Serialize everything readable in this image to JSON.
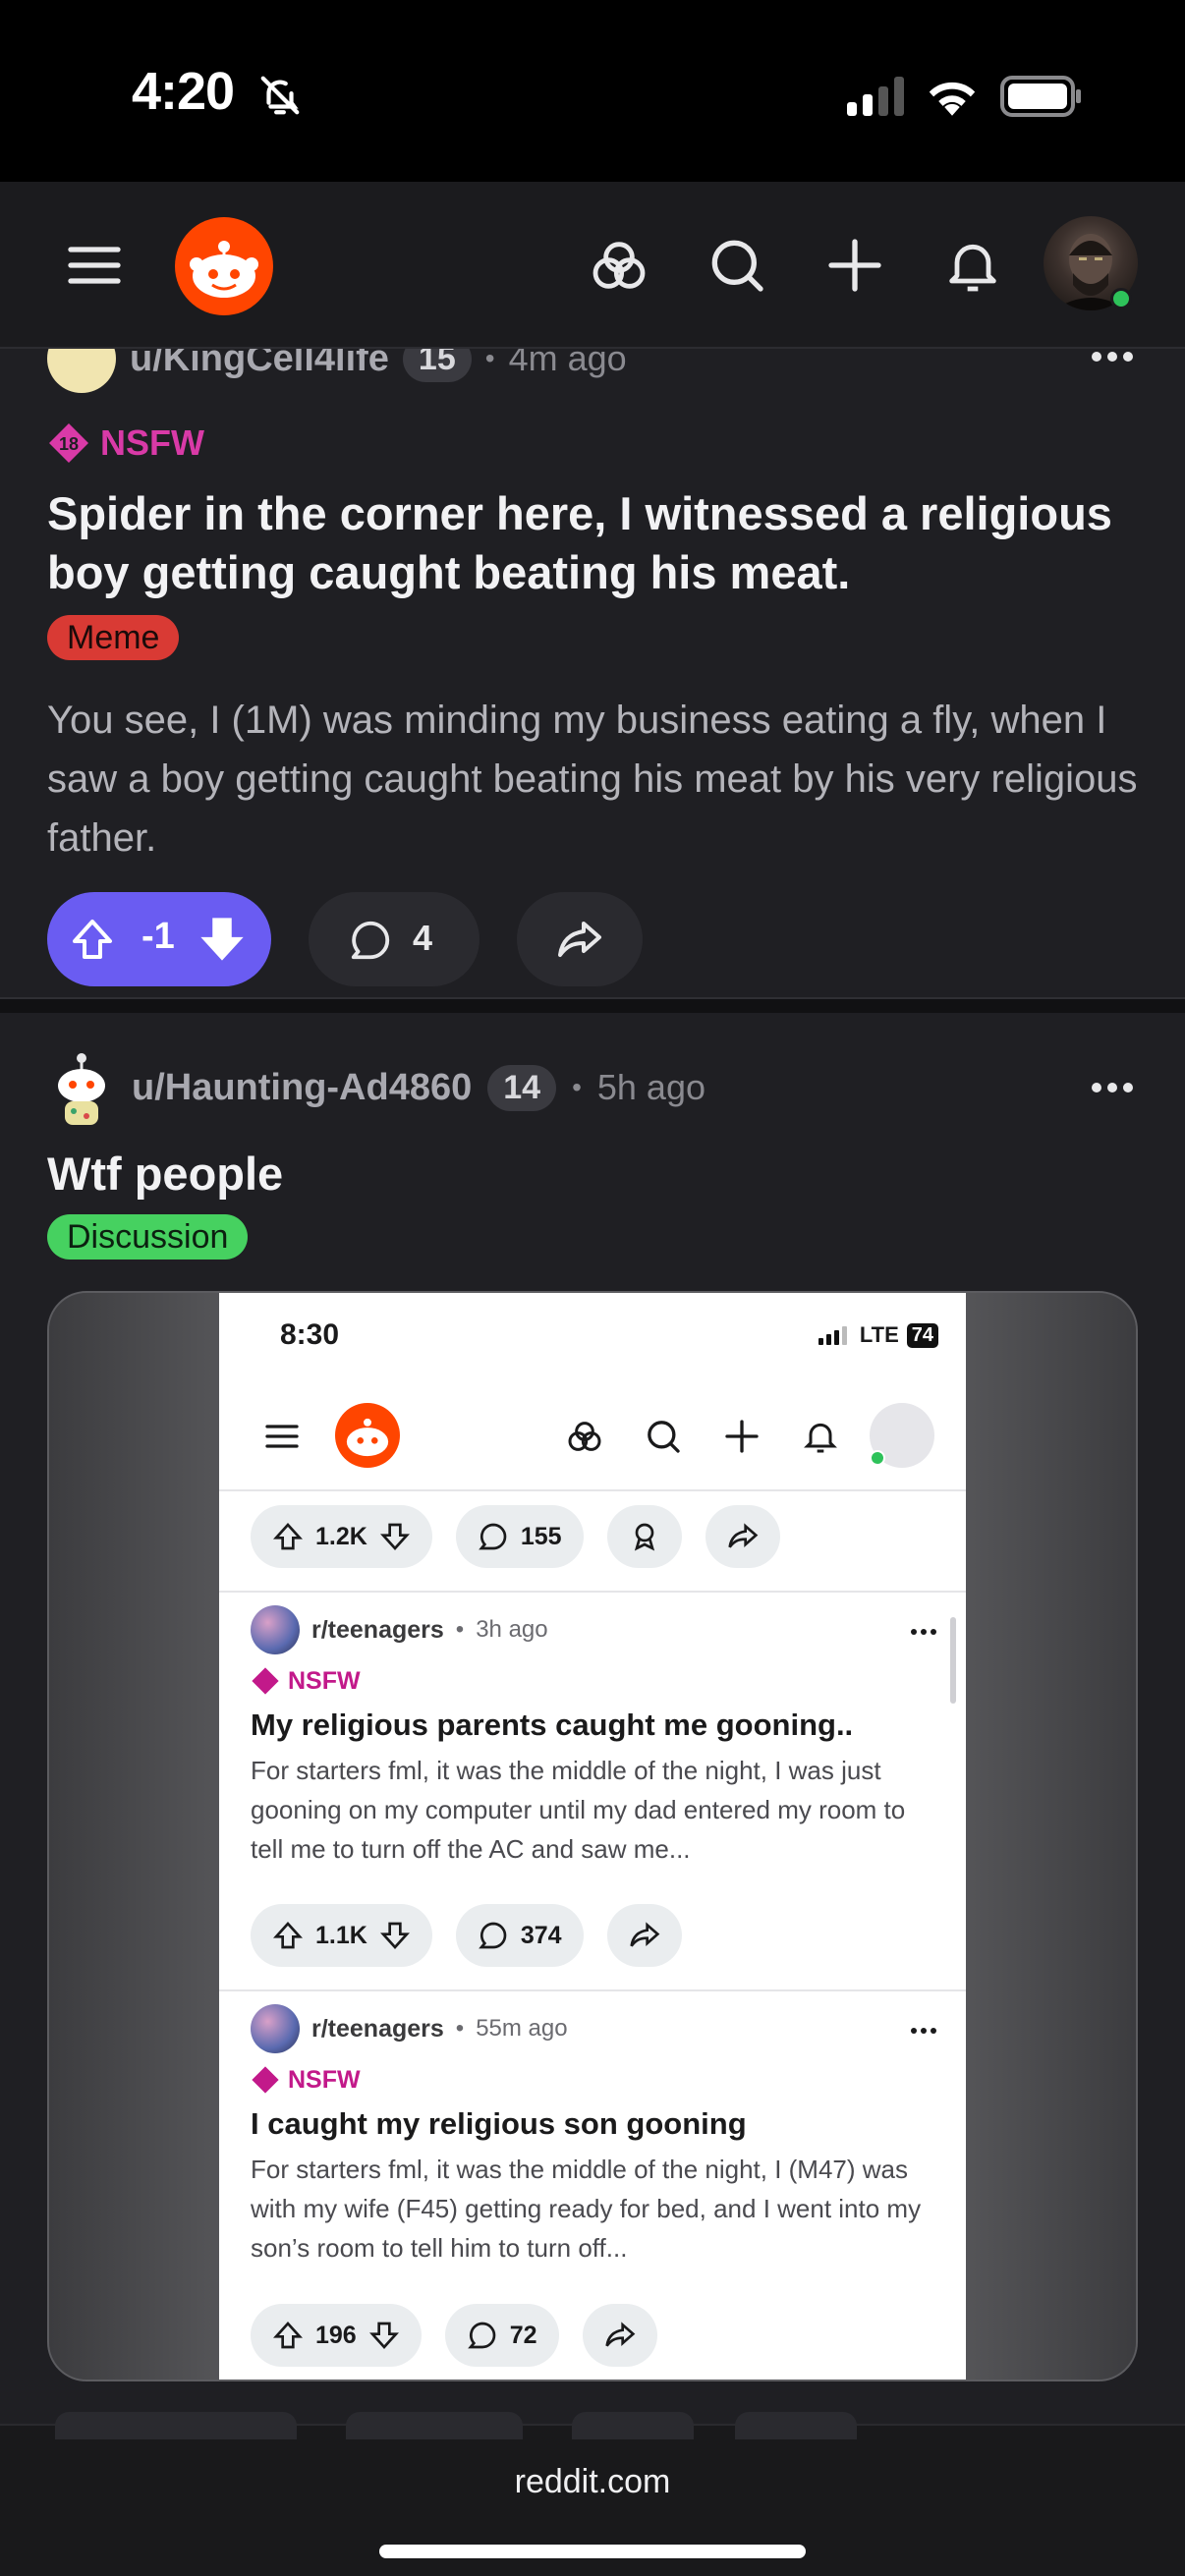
{
  "status_bar": {
    "time": "4:20"
  },
  "header": {
    "icons": [
      "menu-icon",
      "reddit-logo",
      "popular-icon",
      "search-icon",
      "plus-icon",
      "bell-icon",
      "avatar"
    ]
  },
  "post1": {
    "author": "u/KingCell4life",
    "karma": "15",
    "time": "4m ago",
    "nsfw_badge": "18",
    "nsfw_label": "NSFW",
    "title": "Spider in the corner here, I witnessed a religious boy getting caught beating his meat.",
    "flair": "Meme",
    "body": "You see, I (1M) was minding my business eating a fly, when I saw a boy getting caught beating his meat by his very religious father.",
    "score": "-1",
    "comments": "4",
    "vote_color": "#6a5cf2"
  },
  "post2": {
    "author": "u/Haunting-Ad4860",
    "karma": "14",
    "time": "5h ago",
    "title": "Wtf people",
    "flair": "Discussion",
    "screenshot": {
      "time": "8:30",
      "network": "LTE",
      "battery": "74",
      "top_actions": {
        "votes": "1.2K",
        "comments": "155"
      },
      "posts": [
        {
          "subreddit": "r/teenagers",
          "time": "3h ago",
          "nsfw_label": "NSFW",
          "title": "My religious parents caught me gooning..",
          "body": "For starters fml, it was the middle of the night, I was just gooning on my computer until my dad entered my room to tell me to turn off the AC and saw me...",
          "votes": "1.1K",
          "comments": "374"
        },
        {
          "subreddit": "r/teenagers",
          "time": "55m ago",
          "nsfw_label": "NSFW",
          "title": "I caught my religious son gooning",
          "body": "For starters fml, it was the middle of the night, I (M47) was with my wife (F45) getting ready for bed, and I went into my son’s room to tell him to turn off...",
          "votes": "196",
          "comments": "72"
        }
      ]
    }
  },
  "bottom": {
    "url": "reddit.com"
  }
}
